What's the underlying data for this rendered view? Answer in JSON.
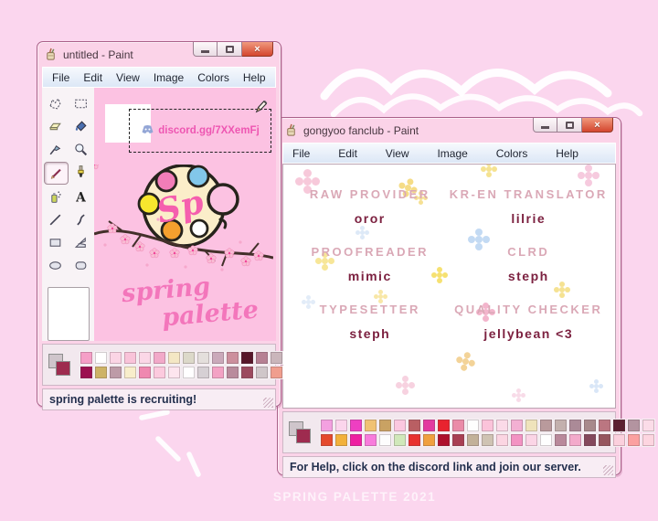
{
  "background": {
    "color": "#fbd6ee",
    "watermark": "SPRING PALETTE 2021"
  },
  "icons": {
    "close_glyph": "×",
    "paint_app_icon": "paint-cup-with-brushes",
    "discord_icon": "discord-mascot",
    "pencil_cursor": "pencil-cursor",
    "flower_decoration": "four-petal-flower"
  },
  "left_window": {
    "title": "untitled - Paint",
    "menu": [
      "File",
      "Edit",
      "View",
      "Image",
      "Colors",
      "Help"
    ],
    "toolbox": {
      "tools": [
        "freeform-select",
        "select",
        "eraser",
        "fill",
        "color-picker",
        "magnifier",
        "pencil",
        "brush",
        "airbrush",
        "text",
        "line",
        "curve",
        "rectangle",
        "polygon",
        "ellipse",
        "rounded-rectangle"
      ],
      "selected": "pencil"
    },
    "canvas": {
      "discord_link": "discord.gg/7XXemFj",
      "monogram": "Sp",
      "script_line1": "spring",
      "script_line2": "palette",
      "canvas_color": "#fcc2e2"
    },
    "palette": {
      "foreground": "#9e2b4f",
      "background": "#cfc5cb",
      "rows": [
        [
          "#f59fc7",
          "#ffffff",
          "#fbd5e5",
          "#f9c3d9",
          "#fbd7e7",
          "#f2a9c9",
          "#f4e7c4",
          "#dcd9c9",
          "#e4dfdc",
          "#caa9ba",
          "#cc8f9d",
          "#571629",
          "#b68093",
          "#cab6bb"
        ],
        [
          "#9c1150",
          "#cdb366",
          "#bd9ba7",
          "#f8eecb",
          "#ef88b0",
          "#fccade",
          "#fde5ee",
          "#ffffff",
          "#d6d0d4",
          "#f3a2c4",
          "#b98b9c",
          "#9c4a5f",
          "#cfc6c9",
          "#f09e8e"
        ]
      ]
    },
    "status": "spring palette is recruiting!"
  },
  "right_window": {
    "title": "gongyoo fanclub - Paint",
    "menu": [
      "File",
      "Edit",
      "View",
      "Image",
      "Colors",
      "Help"
    ],
    "roles": [
      {
        "title": "RAW PROVIDER",
        "name": "oror"
      },
      {
        "title": "KR-EN TRANSLATOR",
        "name": "lilrie"
      },
      {
        "title": "PROOFREADER",
        "name": "mimic"
      },
      {
        "title": "CLRD",
        "name": "steph"
      },
      {
        "title": "TYPESETTER",
        "name": "steph"
      },
      {
        "title": "QUALITY CHECKER",
        "name": "jellybean <3"
      }
    ],
    "palette": {
      "foreground": "#9e2b4f",
      "background": "#cfc5cb",
      "rows": [
        [
          "#f3a0e0",
          "#fbd5ec",
          "#ee3fc2",
          "#f0c273",
          "#c9a263",
          "#fbc8e0",
          "#b95f63",
          "#e339a0",
          "#e8232f",
          "#ea8ba8",
          "#fefefe",
          "#fbc3da",
          "#fbdae8",
          "#f3b0d3",
          "#efe3bb",
          "#b99a9c",
          "#c3b0ad",
          "#ab8a97",
          "#a88a8c",
          "#bb7681",
          "#5c2031",
          "#b394a0",
          "#fbdce8"
        ],
        [
          "#e5492c",
          "#f2b13b",
          "#ee1ea1",
          "#f87cdc",
          "#fdfdfd",
          "#d0e8ba",
          "#e8312f",
          "#f0a03f",
          "#ae102c",
          "#a83f53",
          "#c2b199",
          "#cfc3b3",
          "#fbd5e2",
          "#f393c3",
          "#fbd5e6",
          "#fefefe",
          "#b9899b",
          "#f3aacb",
          "#84495c",
          "#96565e",
          "#fbd0dd",
          "#fba0a0",
          "#fdd5e0"
        ]
      ]
    },
    "status": "For Help, click on the discord link and join our server."
  }
}
